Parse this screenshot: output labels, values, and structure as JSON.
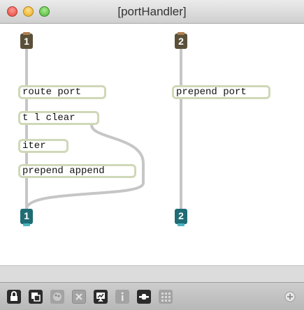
{
  "window": {
    "title": "[portHandler]"
  },
  "patcher": {
    "inlets": [
      {
        "number": "1"
      },
      {
        "number": "2"
      }
    ],
    "outlets": [
      {
        "number": "1"
      },
      {
        "number": "2"
      }
    ],
    "objects": [
      {
        "text": "route port"
      },
      {
        "text": "t l clear"
      },
      {
        "text": "iter"
      },
      {
        "text": "prepend append"
      },
      {
        "text": "prepend port"
      }
    ]
  },
  "toolbar": {
    "icons": [
      "lock-icon",
      "presentation-icon",
      "paint-icon",
      "close-box-icon",
      "debug-icon",
      "info-icon",
      "connect-icon",
      "grid-icon",
      "add-icon"
    ]
  },
  "colors": {
    "inlet": "#5a5039",
    "outlet": "#1f6c74",
    "object_border": "#cfd8b8",
    "wire": "#c6c6c6"
  }
}
